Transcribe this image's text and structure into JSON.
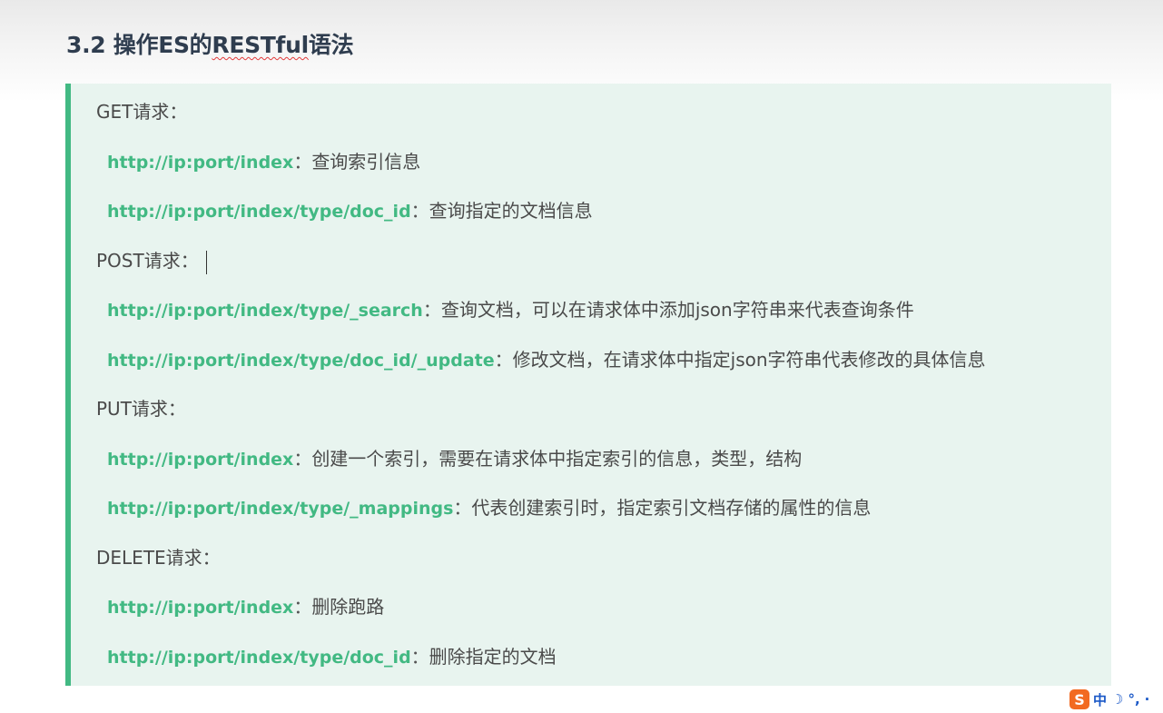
{
  "heading": {
    "prefix": "3.2 操作ES的",
    "term": "RESTful",
    "suffix": "语法"
  },
  "groups": [
    {
      "label": "GET请求：",
      "endpoints": [
        {
          "url": "http://ip:port/index",
          "sep": "：",
          "desc": "查询索引信息"
        },
        {
          "url": "http://ip:port/index/type/doc_id",
          "sep": "：",
          "desc": "查询指定的文档信息"
        }
      ]
    },
    {
      "label": "POST请求：",
      "endpoints": [
        {
          "url": "http://ip:port/index/type/_search",
          "sep": "：",
          "desc": "查询文档，可以在请求体中添加json字符串来代表查询条件"
        },
        {
          "url": "http://ip:port/index/type/doc_id/_update",
          "sep": "：",
          "desc": "修改文档，在请求体中指定json字符串代表修改的具体信息"
        }
      ]
    },
    {
      "label": "PUT请求：",
      "endpoints": [
        {
          "url": "http://ip:port/index",
          "sep": "：",
          "desc": "创建一个索引，需要在请求体中指定索引的信息，类型，结构"
        },
        {
          "url": "http://ip:port/index/type/_mappings",
          "sep": "：",
          "desc": "代表创建索引时，指定索引文档存储的属性的信息"
        }
      ]
    },
    {
      "label": "DELETE请求：",
      "endpoints": [
        {
          "url": "http://ip:port/index",
          "sep": "：",
          "desc": "删除跑路"
        },
        {
          "url": "http://ip:port/index/type/doc_id",
          "sep": "：",
          "desc": "删除指定的文档"
        }
      ]
    }
  ],
  "ime": {
    "logo": "S",
    "mode": "中",
    "moon": "☽",
    "punct": "°,",
    "dot": "·"
  },
  "colors": {
    "accent": "#42b983",
    "box_bg": "#e8f4ef",
    "heading": "#2f3d4f",
    "ime_logo": "#f26a21"
  }
}
